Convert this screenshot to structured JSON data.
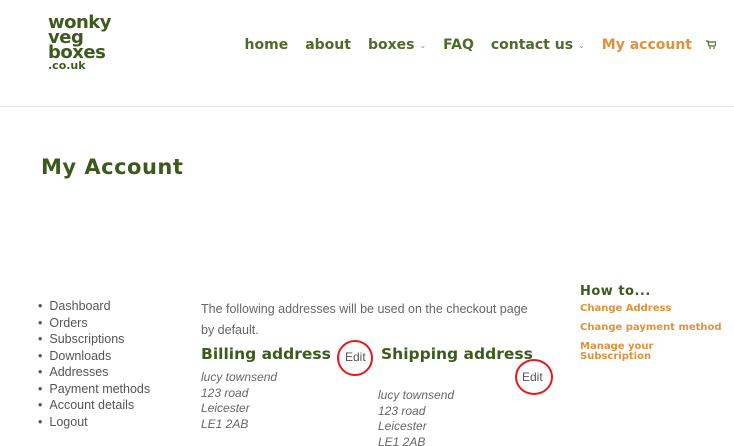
{
  "logo": {
    "line1": "wonky",
    "line2": "veg",
    "line3": "boxes",
    "line4": ".co.uk"
  },
  "nav": {
    "items": [
      {
        "label": "home",
        "dropdown": false,
        "active": false
      },
      {
        "label": "about",
        "dropdown": false,
        "active": false
      },
      {
        "label": "boxes",
        "dropdown": true,
        "active": false
      },
      {
        "label": "FAQ",
        "dropdown": false,
        "active": false
      },
      {
        "label": "contact us",
        "dropdown": true,
        "active": false
      },
      {
        "label": "My account",
        "dropdown": false,
        "active": true
      }
    ],
    "cart_icon": "cart-icon"
  },
  "page": {
    "title": "My Account"
  },
  "account_nav": [
    "Dashboard",
    "Orders",
    "Subscriptions",
    "Downloads",
    "Addresses",
    "Payment methods",
    "Account details",
    "Logout"
  ],
  "addresses": {
    "intro": "The following addresses will be used on the checkout page by default.",
    "billing": {
      "title": "Billing address",
      "edit": "Edit",
      "lines": [
        "lucy townsend",
        "123 road",
        "Leicester",
        "LE1 2AB"
      ]
    },
    "shipping": {
      "title": "Shipping address",
      "edit": "Edit",
      "lines": [
        "lucy townsend",
        "123 road",
        "Leicester",
        "LE1 2AB"
      ]
    }
  },
  "howto": {
    "title": "How to...",
    "links": [
      "Change Address",
      "Change payment method",
      "Manage your Subscription"
    ]
  },
  "colors": {
    "brand_green": "#3d5a1e",
    "nav_green": "#4e6b2a",
    "accent_orange": "#e0923a",
    "annotation_red": "#e01b1b"
  }
}
